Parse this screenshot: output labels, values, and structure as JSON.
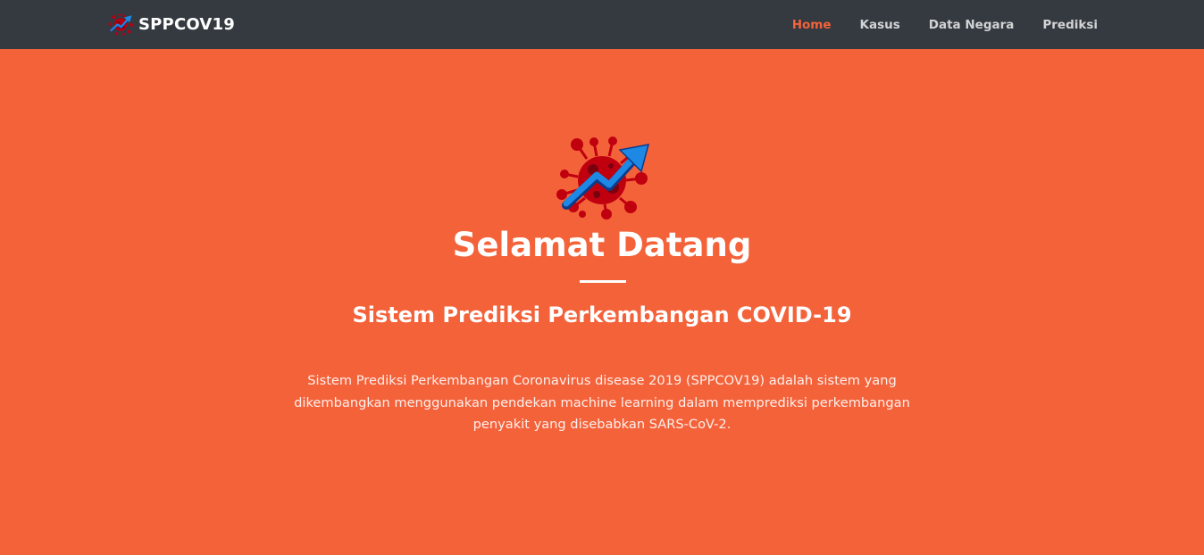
{
  "navbar": {
    "brand": {
      "logo_icon": "virus-trend-logo-icon",
      "text": "SPPCOV19"
    },
    "items": [
      {
        "label": "Home",
        "active": true
      },
      {
        "label": "Kasus",
        "active": false
      },
      {
        "label": "Data Negara",
        "active": false
      },
      {
        "label": "Prediksi",
        "active": false
      }
    ]
  },
  "hero": {
    "logo_icon": "virus-trend-logo-icon",
    "title": "Selamat Datang",
    "subtitle": "Sistem Prediksi Perkembangan COVID-19",
    "description": "Sistem Prediksi Perkembangan Coronavirus disease 2019 (SPPCOV19) adalah sistem yang dikembangkan menggunakan pendekan machine learning dalam memprediksi perkembangan penyakit yang disebabkan SARS-CoV-2."
  },
  "colors": {
    "navbar_bg": "#343a40",
    "hero_bg": "#f4623a",
    "active_link": "#f4623a",
    "virus_red": "#c0000f",
    "arrow_blue": "#1e88e5"
  }
}
